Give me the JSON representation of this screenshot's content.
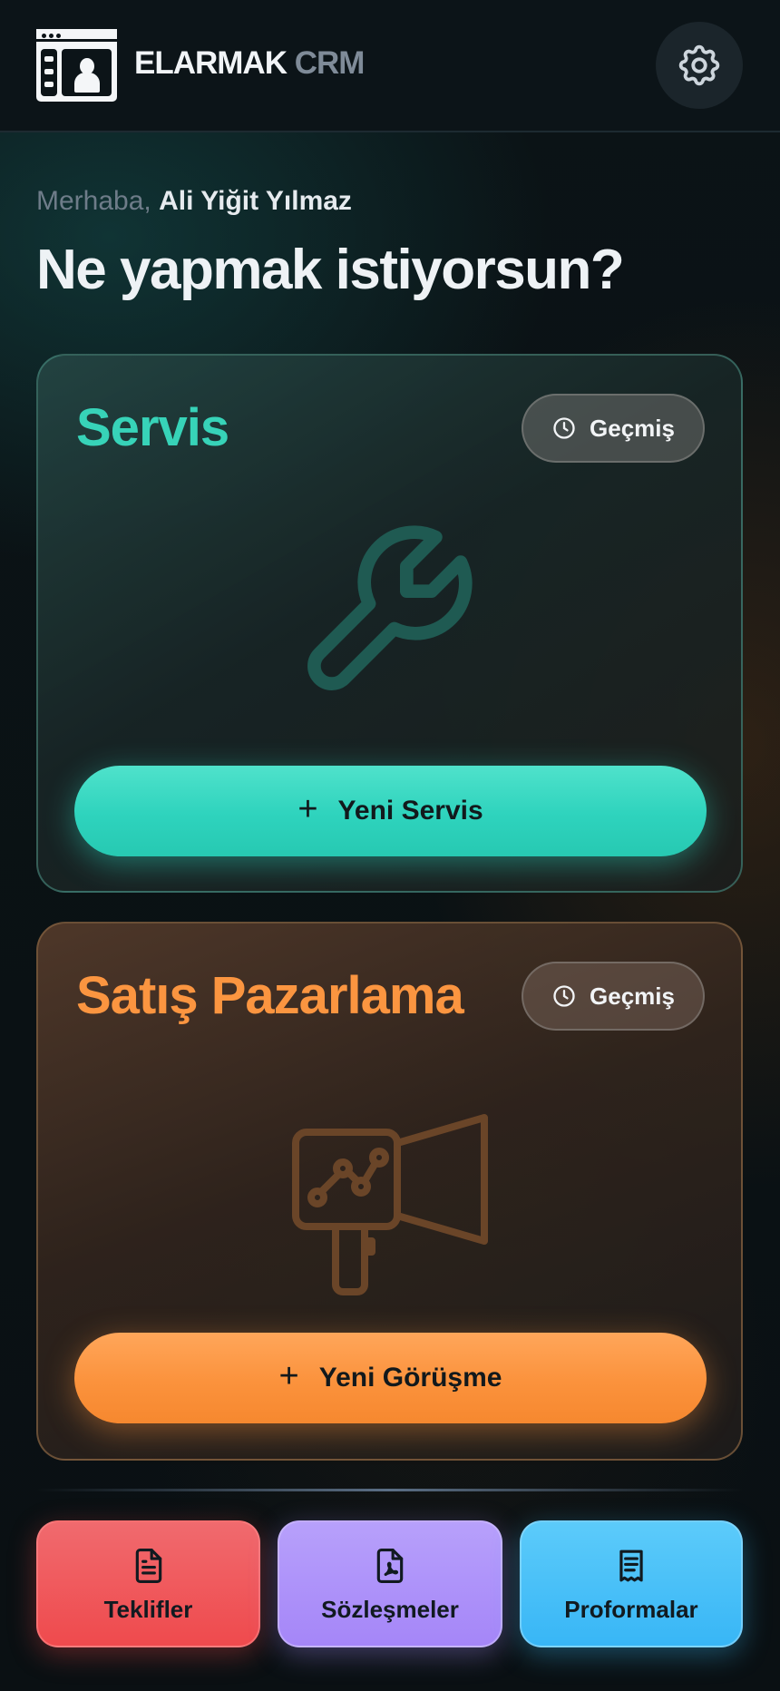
{
  "header": {
    "brand_primary": "ELARMAK",
    "brand_secondary": "CRM",
    "logo_icon": "app-logo-icon",
    "settings_icon": "gear-icon"
  },
  "greeting": {
    "prefix": "Merhaba,",
    "user_name": "Ali Yiğit Yılmaz",
    "question": "Ne yapmak istiyorsun?"
  },
  "cards": {
    "service": {
      "title": "Servis",
      "history_label": "Geçmiş",
      "illustration_icon": "wrench-icon",
      "primary_label": "Yeni Servis",
      "accent": "#2dd4bf"
    },
    "sales": {
      "title": "Satış Pazarlama",
      "history_label": "Geçmiş",
      "illustration_icon": "megaphone-chart-icon",
      "primary_label": "Yeni Görüşme",
      "accent": "#fb923c"
    }
  },
  "tiles": [
    {
      "label": "Teklifler",
      "icon": "document-icon",
      "color": "#ef4444"
    },
    {
      "label": "Sözleşmeler",
      "icon": "pdf-file-icon",
      "color": "#a78bfa"
    },
    {
      "label": "Proformalar",
      "icon": "receipt-icon",
      "color": "#38bdf8"
    }
  ]
}
